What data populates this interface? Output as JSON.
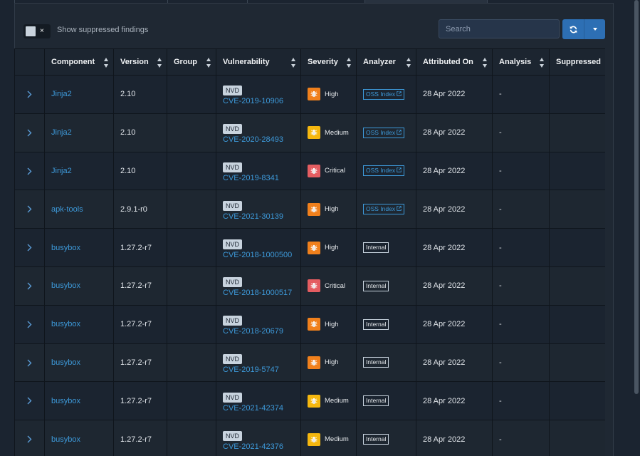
{
  "toolbar": {
    "suppress_toggle_mark": "×",
    "suppress_label": "Show suppressed findings",
    "search_placeholder": "Search"
  },
  "columns": [
    "Component",
    "Version",
    "Group",
    "Vulnerability",
    "Severity",
    "Analyzer",
    "Attributed On",
    "Analysis",
    "Suppressed"
  ],
  "severity_colors": {
    "High": "#f0801c",
    "Medium": "#f5b70f",
    "Critical": "#e45d61"
  },
  "rows": [
    {
      "component": "Jinja2",
      "version": "2.10",
      "group": "",
      "source": "NVD",
      "vuln": "CVE-2019-10906",
      "severity": "High",
      "analyzer": "OSS Index",
      "attributed": "28 Apr 2022",
      "analysis": "-",
      "suppressed": ""
    },
    {
      "component": "Jinja2",
      "version": "2.10",
      "group": "",
      "source": "NVD",
      "vuln": "CVE-2020-28493",
      "severity": "Medium",
      "analyzer": "OSS Index",
      "attributed": "28 Apr 2022",
      "analysis": "-",
      "suppressed": ""
    },
    {
      "component": "Jinja2",
      "version": "2.10",
      "group": "",
      "source": "NVD",
      "vuln": "CVE-2019-8341",
      "severity": "Critical",
      "analyzer": "OSS Index",
      "attributed": "28 Apr 2022",
      "analysis": "-",
      "suppressed": ""
    },
    {
      "component": "apk-tools",
      "version": "2.9.1-r0",
      "group": "",
      "source": "NVD",
      "vuln": "CVE-2021-30139",
      "severity": "High",
      "analyzer": "OSS Index",
      "attributed": "28 Apr 2022",
      "analysis": "-",
      "suppressed": ""
    },
    {
      "component": "busybox",
      "version": "1.27.2-r7",
      "group": "",
      "source": "NVD",
      "vuln": "CVE-2018-1000500",
      "severity": "High",
      "analyzer": "Internal",
      "attributed": "28 Apr 2022",
      "analysis": "-",
      "suppressed": ""
    },
    {
      "component": "busybox",
      "version": "1.27.2-r7",
      "group": "",
      "source": "NVD",
      "vuln": "CVE-2018-1000517",
      "severity": "Critical",
      "analyzer": "Internal",
      "attributed": "28 Apr 2022",
      "analysis": "-",
      "suppressed": ""
    },
    {
      "component": "busybox",
      "version": "1.27.2-r7",
      "group": "",
      "source": "NVD",
      "vuln": "CVE-2018-20679",
      "severity": "High",
      "analyzer": "Internal",
      "attributed": "28 Apr 2022",
      "analysis": "-",
      "suppressed": ""
    },
    {
      "component": "busybox",
      "version": "1.27.2-r7",
      "group": "",
      "source": "NVD",
      "vuln": "CVE-2019-5747",
      "severity": "High",
      "analyzer": "Internal",
      "attributed": "28 Apr 2022",
      "analysis": "-",
      "suppressed": ""
    },
    {
      "component": "busybox",
      "version": "1.27.2-r7",
      "group": "",
      "source": "NVD",
      "vuln": "CVE-2021-42374",
      "severity": "Medium",
      "analyzer": "Internal",
      "attributed": "28 Apr 2022",
      "analysis": "-",
      "suppressed": ""
    },
    {
      "component": "busybox",
      "version": "1.27.2-r7",
      "group": "",
      "source": "NVD",
      "vuln": "CVE-2021-42376",
      "severity": "Medium",
      "analyzer": "Internal",
      "attributed": "28 Apr 2022",
      "analysis": "-",
      "suppressed": ""
    }
  ]
}
